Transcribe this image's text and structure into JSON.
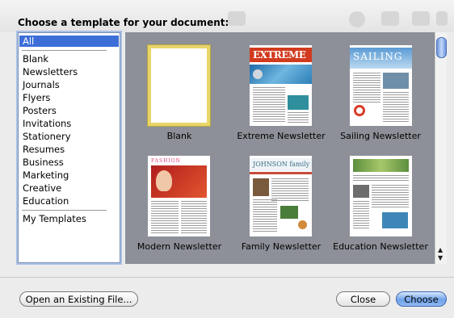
{
  "dialog": {
    "prompt": "Choose a template for your document:"
  },
  "categories": {
    "selected": "All",
    "items": [
      "Blank",
      "Newsletters",
      "Journals",
      "Flyers",
      "Posters",
      "Invitations",
      "Stationery",
      "Resumes",
      "Business",
      "Marketing",
      "Creative",
      "Education"
    ],
    "user": "My Templates"
  },
  "templates": [
    {
      "label": "Blank"
    },
    {
      "label": "Extreme Newsletter",
      "masthead": "EXTREME"
    },
    {
      "label": "Sailing Newsletter",
      "masthead": "SAILING"
    },
    {
      "label": "Modern Newsletter",
      "masthead": "FASHION"
    },
    {
      "label": "Family Newsletter",
      "masthead": "JOHNSON family"
    },
    {
      "label": "Education Newsletter"
    }
  ],
  "buttons": {
    "open": "Open an Existing File...",
    "close": "Close",
    "choose": "Choose"
  },
  "colors": {
    "selection": "#3d6ed8",
    "grid_background": "#8d9098",
    "selected_tile_border": "#e7d56a"
  }
}
